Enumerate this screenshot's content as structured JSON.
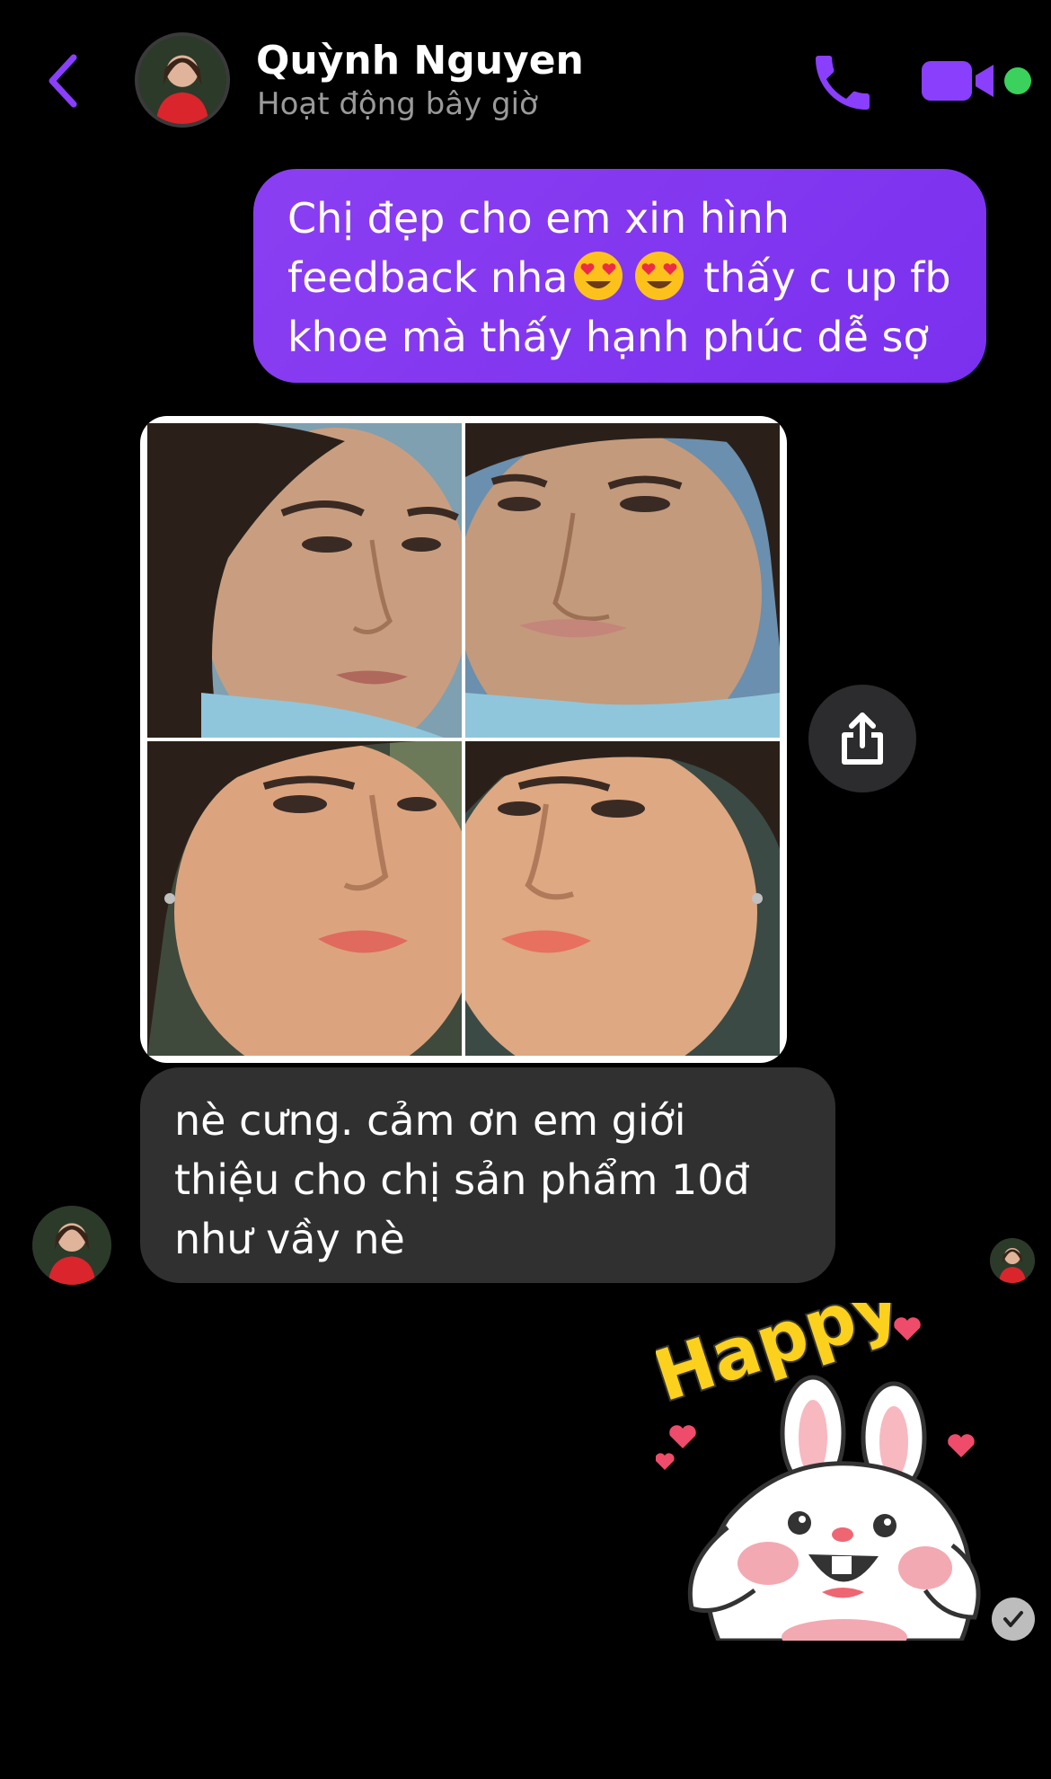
{
  "header": {
    "contact_name": "Quỳnh Nguyen",
    "status": "Hoạt động bây giờ",
    "accent_color": "#8a3ffc",
    "online_color": "#3ad15c"
  },
  "messages": {
    "outgoing": {
      "line1": "Chị đẹp cho em xin hình",
      "line2_before": "feedback nha",
      "line2_after": "thấy c up fb",
      "line3": "khoe mà thấy hạnh phúc dễ sợ",
      "emoji": "heart-eyes"
    },
    "incoming_text": "nè cưng. cảm ơn em giới thiệu cho chị sản phẩm 10đ như vầy nè",
    "sticker_text": "Happy"
  }
}
